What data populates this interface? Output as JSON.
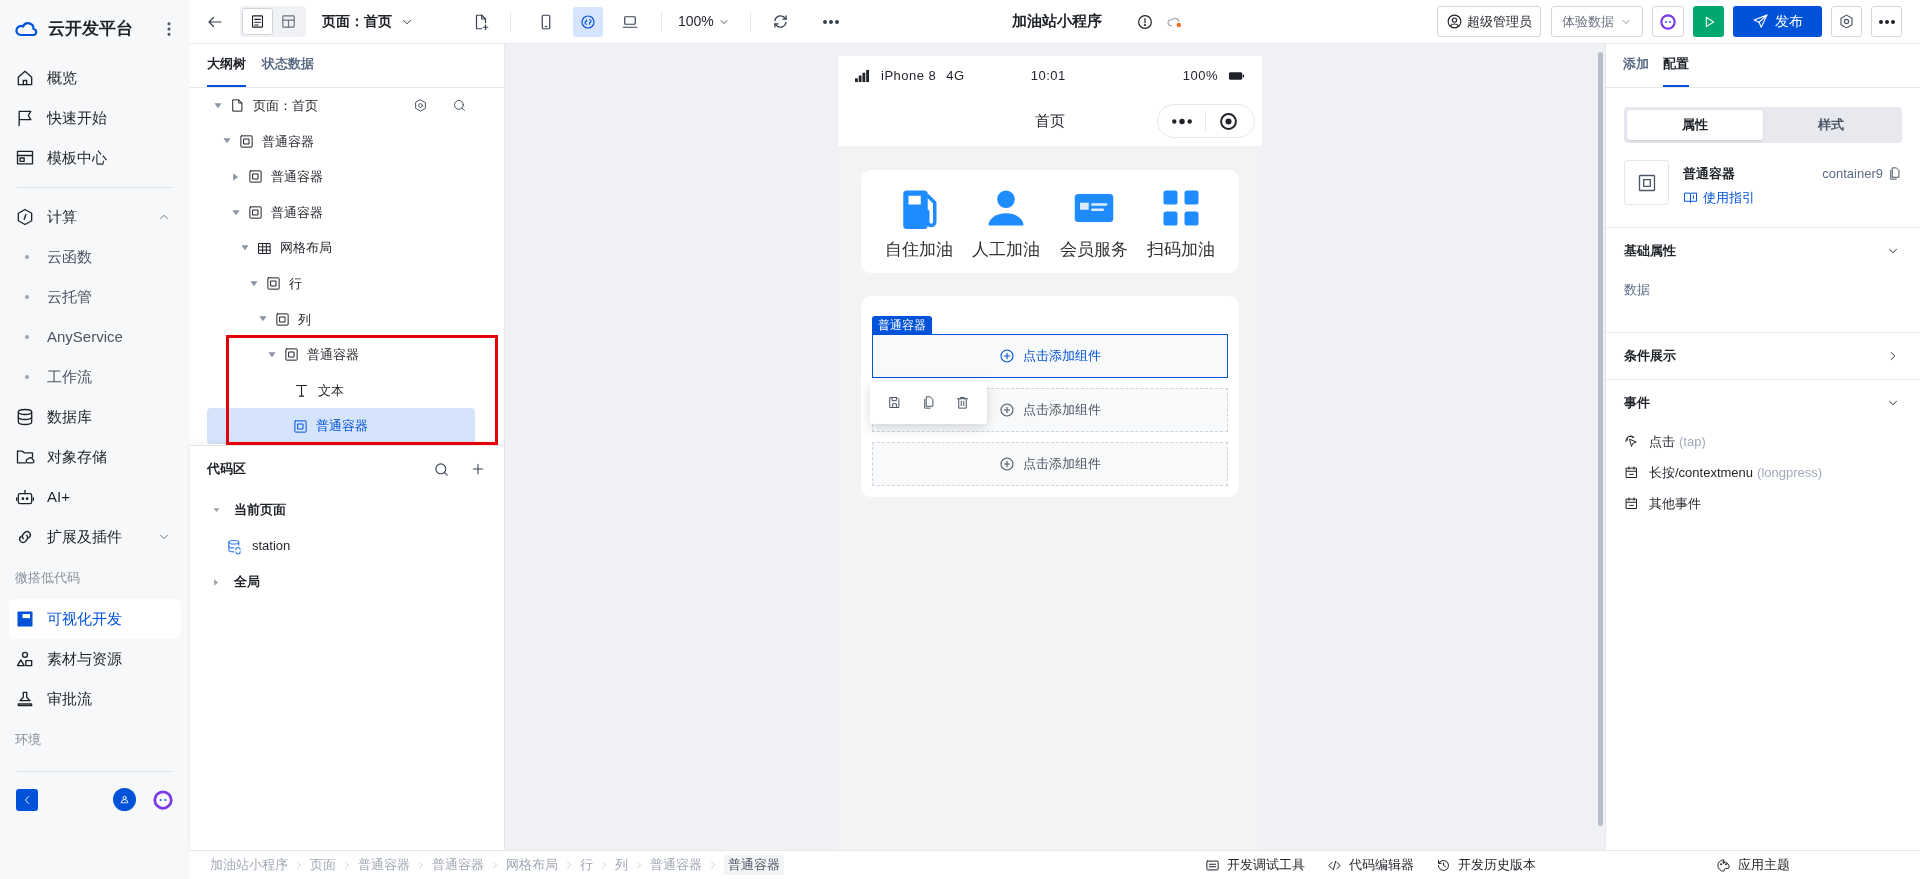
{
  "nav": {
    "brand": "云开发平台",
    "groups": [
      {
        "items": [
          {
            "label": "概览",
            "kind": "item",
            "selected": false
          },
          {
            "label": "快速开始",
            "kind": "item",
            "selected": false
          },
          {
            "label": "模板中心",
            "kind": "item",
            "selected": false
          }
        ]
      },
      {
        "items": [
          {
            "label": "计算",
            "kind": "group",
            "expanded": true,
            "selected": false
          },
          {
            "label": "云函数",
            "kind": "sub",
            "selected": false
          },
          {
            "label": "云托管",
            "kind": "sub",
            "selected": false
          },
          {
            "label": "AnyService",
            "kind": "sub",
            "selected": false
          },
          {
            "label": "工作流",
            "kind": "sub",
            "selected": false
          },
          {
            "label": "数据库",
            "kind": "item",
            "selected": false
          },
          {
            "label": "对象存储",
            "kind": "item",
            "selected": false
          },
          {
            "label": "AI+",
            "kind": "item",
            "selected": false
          },
          {
            "label": "扩展及插件",
            "kind": "group",
            "expanded": false,
            "selected": false
          },
          {
            "label": "微搭低代码",
            "kind": "section"
          },
          {
            "label": "可视化开发",
            "kind": "item",
            "selected": true
          },
          {
            "label": "素材与资源",
            "kind": "item",
            "selected": false
          },
          {
            "label": "审批流",
            "kind": "item",
            "selected": false
          },
          {
            "label": "环境",
            "kind": "section"
          }
        ]
      }
    ]
  },
  "toolbar": {
    "view_modes": [
      {
        "selected": true
      },
      {
        "selected": false
      }
    ],
    "page_selector": "页面：首页",
    "devices": [
      {
        "selected": false
      },
      {
        "selected": true
      },
      {
        "selected": false
      }
    ],
    "zoom": "100%",
    "title": "加油站小程序",
    "role_button": "超级管理员",
    "data_select": "体验数据",
    "publish_button": "发布"
  },
  "outline": {
    "tabs": [
      {
        "label": "大纲树",
        "selected": true
      },
      {
        "label": "状态数据",
        "selected": false
      }
    ],
    "tree": [
      {
        "label": "页面：首页",
        "kind": "page",
        "expanded": true,
        "selected": false,
        "children": [
          {
            "label": "普通容器",
            "kind": "container",
            "expanded": true,
            "selected": false,
            "children": [
              {
                "label": "普通容器",
                "kind": "container",
                "expanded": false,
                "selected": false
              },
              {
                "label": "普通容器",
                "kind": "container",
                "expanded": true,
                "selected": false,
                "children": [
                  {
                    "label": "网格布局",
                    "kind": "grid",
                    "expanded": true,
                    "selected": false,
                    "children": [
                      {
                        "label": "行",
                        "kind": "container",
                        "expanded": true,
                        "selected": false,
                        "children": [
                          {
                            "label": "列",
                            "kind": "container",
                            "expanded": true,
                            "selected": false,
                            "children": [
                              {
                                "label": "普通容器",
                                "kind": "container",
                                "expanded": true,
                                "selected": false,
                                "children": [
                                  {
                                    "label": "文本",
                                    "kind": "text",
                                    "selected": false
                                  },
                                  {
                                    "label": "普通容器",
                                    "kind": "container",
                                    "selected": true
                                  }
                                ]
                              }
                            ]
                          }
                        ]
                      }
                    ]
                  }
                ]
              }
            ]
          }
        ]
      }
    ]
  },
  "code_area": {
    "title": "代码区",
    "groups": [
      {
        "label": "当前页面",
        "expanded": true,
        "items": [
          {
            "label": "station"
          }
        ]
      },
      {
        "label": "全局",
        "expanded": false
      }
    ]
  },
  "phone": {
    "status": {
      "device": "iPhone 8",
      "network": "4G",
      "time": "10:01",
      "battery": "100%"
    },
    "title": "首页",
    "shortcuts": [
      {
        "label": "自住加油"
      },
      {
        "label": "人工加油"
      },
      {
        "label": "会员服务"
      },
      {
        "label": "扫码加油"
      }
    ],
    "selected_label": "普通容器",
    "slots": [
      {
        "label": "点击添加组件",
        "selected": true
      },
      {
        "label": "点击添加组件",
        "selected": false
      },
      {
        "label": "点击添加组件",
        "selected": false
      }
    ]
  },
  "config": {
    "tabs": [
      {
        "label": "添加",
        "selected": false
      },
      {
        "label": "配置",
        "selected": true
      }
    ],
    "segments": [
      {
        "label": "属性",
        "selected": true
      },
      {
        "label": "样式",
        "selected": false
      }
    ],
    "component": {
      "name": "普通容器",
      "id": "container9",
      "guide": "使用指引"
    },
    "sections": [
      {
        "title": "基础属性",
        "expanded": true,
        "fields": [
          "数据"
        ]
      },
      {
        "title": "条件展示",
        "expanded": false
      },
      {
        "title": "事件",
        "expanded": true,
        "events": [
          {
            "label": "点击",
            "hint": "(tap)"
          },
          {
            "label": "长按/contextmenu",
            "hint": "(longpress)"
          },
          {
            "label": "其他事件"
          }
        ]
      }
    ]
  },
  "breadcrumb": [
    "加油站小程序",
    "页面",
    "普通容器",
    "普通容器",
    "网格布局",
    "行",
    "列",
    "普通容器",
    "普通容器"
  ],
  "footer_tools": [
    "开发调试工具",
    "代码编辑器",
    "开发历史版本",
    "应用主题"
  ]
}
